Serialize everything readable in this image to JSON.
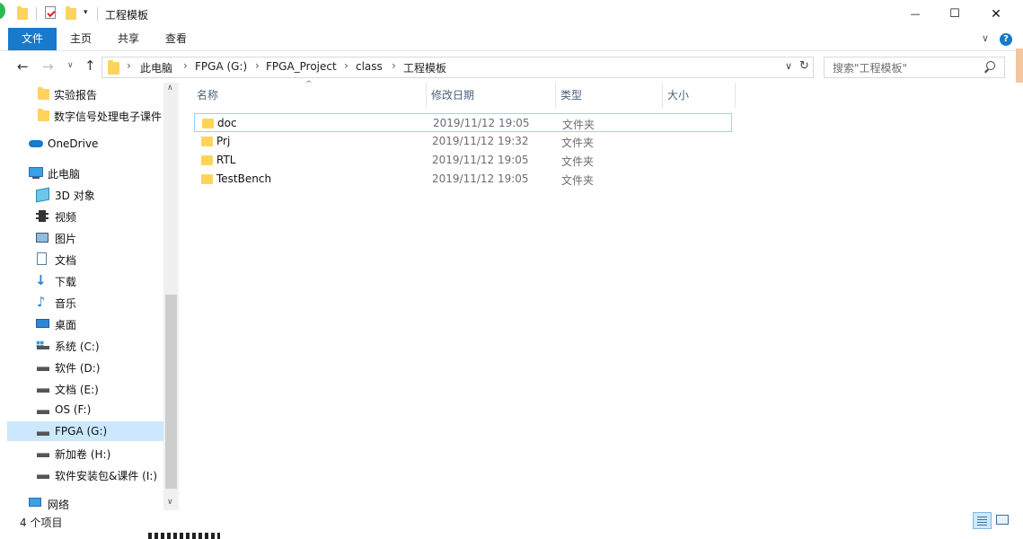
{
  "window": {
    "title": "工程模板",
    "minimize": "—",
    "maximize": "☐",
    "close": "✕"
  },
  "ribbon": {
    "tabs": [
      "文件",
      "主页",
      "共享",
      "查看"
    ],
    "expand": "∨",
    "help": "?"
  },
  "address": {
    "crumbs": [
      "此电脑",
      "FPGA (G:)",
      "FPGA_Project",
      "class",
      "工程模板"
    ],
    "dropdown": "∨",
    "refresh": "↻"
  },
  "search": {
    "placeholder": "搜索\"工程模板\""
  },
  "nav": {
    "items": [
      {
        "label": "实验报告",
        "icon": "folder-icon"
      },
      {
        "label": "数字信号处理电子课件",
        "icon": "folder-icon"
      },
      {
        "label": "OneDrive",
        "icon": "cloud-icon"
      },
      {
        "label": "此电脑",
        "icon": "computer-icon"
      },
      {
        "label": "3D 对象",
        "icon": "3d-objects-icon"
      },
      {
        "label": "视频",
        "icon": "video-icon"
      },
      {
        "label": "图片",
        "icon": "pictures-icon"
      },
      {
        "label": "文档",
        "icon": "documents-icon"
      },
      {
        "label": "下载",
        "icon": "download-icon"
      },
      {
        "label": "音乐",
        "icon": "music-icon"
      },
      {
        "label": "桌面",
        "icon": "desktop-icon"
      },
      {
        "label": "系统 (C:)",
        "icon": "system-drive-icon"
      },
      {
        "label": "软件 (D:)",
        "icon": "drive-icon"
      },
      {
        "label": "文档 (E:)",
        "icon": "drive-icon"
      },
      {
        "label": "OS (F:)",
        "icon": "drive-icon"
      },
      {
        "label": "FPGA (G:)",
        "icon": "drive-icon"
      },
      {
        "label": "新加卷 (H:)",
        "icon": "drive-icon"
      },
      {
        "label": "软件安装包&课件 (I:)",
        "icon": "drive-icon"
      },
      {
        "label": "网络",
        "icon": "network-icon"
      }
    ]
  },
  "columns": {
    "name": "名称",
    "date": "修改日期",
    "type": "类型",
    "size": "大小"
  },
  "files": [
    {
      "name": "doc",
      "date": "2019/11/12 19:05",
      "type": "文件夹"
    },
    {
      "name": "Prj",
      "date": "2019/11/12 19:32",
      "type": "文件夹"
    },
    {
      "name": "RTL",
      "date": "2019/11/12 19:05",
      "type": "文件夹"
    },
    {
      "name": "TestBench",
      "date": "2019/11/12 19:05",
      "type": "文件夹"
    }
  ],
  "status": {
    "count": "4 个项目"
  }
}
